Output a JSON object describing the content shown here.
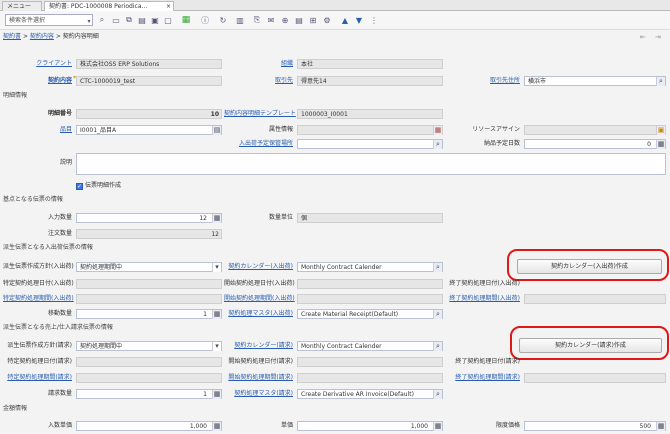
{
  "tabs": {
    "menu": "メニュー",
    "active": "契約書: PDC-1000008 Periodica..."
  },
  "search": {
    "placeholder": "検索条件選択"
  },
  "icons": {
    "save": "save-icon",
    "new": "new-document-icon",
    "copy": "copy-icon",
    "delete": "delete-icon",
    "grid": "grid-toggle-icon",
    "refresh": "refresh-icon",
    "report": "report-icon",
    "attach": "attachment-icon",
    "chat": "chat-icon",
    "zoom": "zoom-across-icon",
    "archive": "archive-icon",
    "export": "export-icon",
    "up": "arrow-up-icon",
    "down": "arrow-down-icon",
    "more": "more-icon"
  },
  "breadcrumb": {
    "item1": "契約書",
    "sep": ">",
    "item2": "契約内容",
    "item3": "契約内容明細"
  },
  "header": {
    "client_label": "クライアント",
    "client_value": "株式会社OSS ERP Solutions",
    "org_label": "組織",
    "org_value": "本社",
    "contract_label": "契約内容",
    "contract_value": "CTC-1000019_test",
    "partner_label": "取引先",
    "partner_value": "得意先14",
    "location_label": "取引先住所",
    "location_value": "横浜市"
  },
  "sections": {
    "detail": "明細情報",
    "base_doc": "基点となる伝票の情報",
    "derived_inout": "派生伝票となる入出荷伝票の情報",
    "derived_invoice": "派生伝票となる売上/仕入請求伝票の情報",
    "amount": "金額情報"
  },
  "detail": {
    "line_label": "明細番号",
    "line_value": "10",
    "template_label": "契約内容明細テンプレート",
    "template_value": "1000003_I0001",
    "product_label": "品目",
    "product_value": "I0001_品目A",
    "attr_label": "属性情報",
    "resource_label": "リソースアサイン",
    "locator_label": "入出荷予定保管場所",
    "days_label": "納品予定日数",
    "days_value": "0",
    "desc_label": "説明",
    "create_line_label": "伝票明細作成"
  },
  "base": {
    "qty_label": "入力数量",
    "qty_value": "12",
    "uom_label": "数量単位",
    "uom_value": "個",
    "order_qty_label": "注文数量",
    "order_qty_value": "12"
  },
  "inout": {
    "policy_label": "派生伝票作成方針(入出荷)",
    "policy_value": "契約処理期間中",
    "calendar_label": "契約カレンダー(入出荷)",
    "calendar_value": "Monthly Contract Calender",
    "button": "契約カレンダー(入出荷)作成",
    "specific_date_label": "特定契約処理日付(入出荷)",
    "start_date_label": "開始契約処理日付(入出荷)",
    "end_date_label": "終了契約処理日付(入出荷)",
    "specific_period_label": "特定契約処理期間(入出荷)",
    "start_period_label": "開始契約処理期間(入出荷)",
    "end_period_label": "終了契約処理期間(入出荷)",
    "move_qty_label": "移動数量",
    "move_qty_value": "1",
    "master_label": "契約処理マスタ(入出荷)",
    "master_value": "Create Material Receipt(Default)"
  },
  "invoice": {
    "policy_label": "派生伝票作成方針(請求)",
    "policy_value": "契約処理期間中",
    "calendar_label": "契約カレンダー(請求)",
    "calendar_value": "Monthly Contract Calender",
    "button": "契約カレンダー(請求)作成",
    "specific_date_label": "特定契約処理日付(請求)",
    "start_date_label": "開始契約処理日付(請求)",
    "end_date_label": "終了契約処理日付(請求)",
    "specific_period_label": "特定契約処理期間(請求)",
    "start_period_label": "開始契約処理期間(請求)",
    "end_period_label": "終了契約処理期間(請求)",
    "qty_label": "請求数量",
    "qty_value": "1",
    "master_label": "契約処理マスタ(請求)",
    "master_value": "Create Derivative AR Invoice(Default)"
  },
  "amount": {
    "price_label": "入数単価",
    "price_value": "1,000",
    "unit_label": "単価",
    "unit_value": "1,000",
    "limit_label": "限度価格",
    "limit_value": "500"
  },
  "colors": {
    "link": "#2a5db0",
    "highlight": "#e01818",
    "mandatory": "#c9a000"
  }
}
